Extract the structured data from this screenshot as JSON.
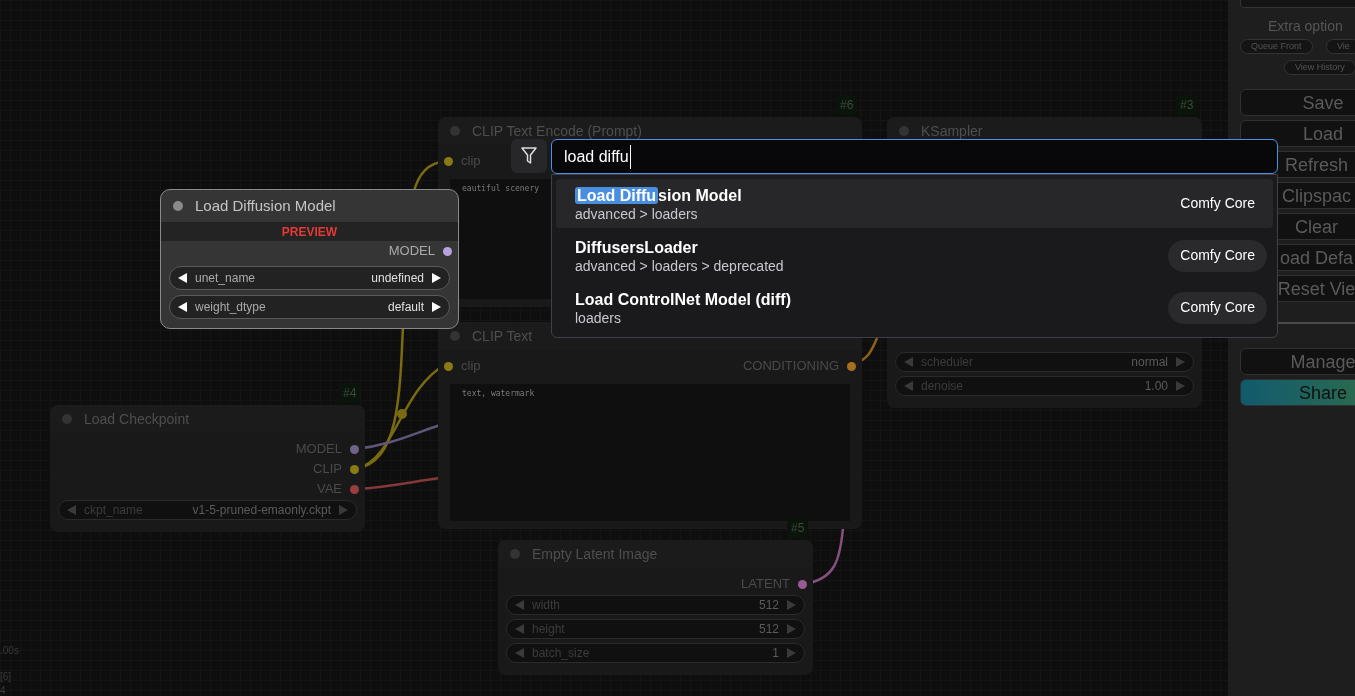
{
  "canvas": {
    "nodes": [
      {
        "id": "#6",
        "title": "CLIP Text Encode (Prompt)",
        "inputs": [
          {
            "label": "clip",
            "color": "#8a7a14"
          }
        ],
        "text": "eautiful scenery"
      },
      {
        "id": "#3",
        "title": "KSampler",
        "widgets": [
          {
            "name": "scheduler",
            "value": "normal"
          },
          {
            "name": "denoise",
            "value": "1.00"
          }
        ]
      },
      {
        "title": "CLIP Text",
        "inputs": [
          {
            "label": "clip",
            "color": "#8a7a14"
          }
        ],
        "outputs": [
          {
            "label": "CONDITIONING",
            "color": "#a8701e"
          }
        ],
        "text": "text, watermark"
      },
      {
        "id": "#4",
        "title": "Load Checkpoint",
        "outputs": [
          {
            "label": "MODEL",
            "color": "#6e6488"
          },
          {
            "label": "CLIP",
            "color": "#8a7a14"
          },
          {
            "label": "VAE",
            "color": "#9a3e3e"
          }
        ],
        "widgets": [
          {
            "name": "ckpt_name",
            "value": "v1-5-pruned-emaonly.ckpt"
          }
        ]
      },
      {
        "id": "#5",
        "title": "Empty Latent Image",
        "outputs": [
          {
            "label": "LATENT",
            "color": "#9a5a96"
          }
        ],
        "widgets": [
          {
            "name": "width",
            "value": "512"
          },
          {
            "name": "height",
            "value": "512"
          },
          {
            "name": "batch_size",
            "value": "1"
          }
        ]
      }
    ],
    "stats": [
      ".00s",
      "[6]",
      "4"
    ]
  },
  "preview_node": {
    "title": "Load Diffusion Model",
    "banner": "PREVIEW",
    "outputs": [
      {
        "label": "MODEL",
        "color": "#b6a2dc"
      }
    ],
    "widgets": [
      {
        "name": "unet_name",
        "value": "undefined"
      },
      {
        "name": "weight_dtype",
        "value": "default"
      }
    ]
  },
  "search": {
    "query": "load diffu",
    "results": [
      {
        "match": "Load Diffu",
        "title": "sion Model",
        "category": "advanced > loaders",
        "source": "Comfy Core",
        "selected": true
      },
      {
        "title": "DiffusersLoader",
        "category": "advanced > loaders > deprecated",
        "source": "Comfy Core",
        "selected": false
      },
      {
        "title": "Load ControlNet Model (diff)",
        "category": "loaders",
        "source": "Comfy Core",
        "selected": false
      }
    ]
  },
  "sidebar": {
    "heading": "Extra option",
    "small_buttons": [
      "Queue Front",
      "Vie",
      "View History"
    ],
    "buttons": [
      {
        "label": "Save",
        "kind": "plain"
      },
      {
        "label": "Load",
        "kind": "plain"
      },
      {
        "label": "Refresh",
        "kind": "plain"
      },
      {
        "label": "Clipspac",
        "kind": "plain"
      },
      {
        "label": "Clear",
        "kind": "plain"
      },
      {
        "label": "oad Defa",
        "kind": "plain"
      },
      {
        "label": "Reset Vie",
        "kind": "plain"
      },
      {
        "label": "Manage",
        "kind": "plain"
      },
      {
        "label": "Share",
        "kind": "accent"
      }
    ]
  }
}
